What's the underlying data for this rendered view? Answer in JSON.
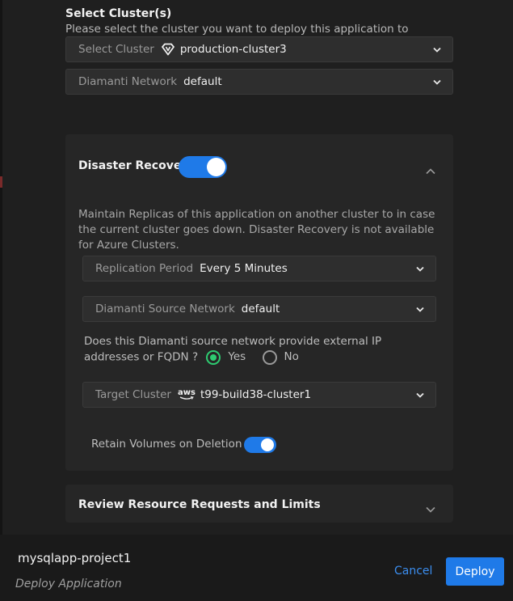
{
  "select_clusters": {
    "title": "Select Cluster(s)",
    "subtitle": "Please select the cluster you want to deploy this application to",
    "cluster_label": "Select Cluster",
    "cluster_value": "production-cluster3",
    "cluster_icon": "diamanti-logo-icon",
    "network_label": "Diamanti Network",
    "network_value": "default"
  },
  "disaster_recovery": {
    "title": "Disaster Recovery",
    "enabled": true,
    "expanded": true,
    "description": "Maintain Replicas of this application on another cluster to in case the current cluster goes down. Disaster Recovery is not available for Azure Clusters.",
    "replication_label": "Replication Period",
    "replication_value": "Every 5 Minutes",
    "source_network_label": "Diamanti Source Network",
    "source_network_value": "default",
    "question": "Does this Diamanti source network provide external IP addresses or FQDN ?",
    "options": [
      {
        "label": "Yes",
        "selected": true
      },
      {
        "label": "No",
        "selected": false
      }
    ],
    "target_label": "Target Cluster",
    "target_icon_text": "aws",
    "target_value": "t99-build38-cluster1",
    "retain_label": "Retain Volumes on Deletion",
    "retain_enabled": true
  },
  "review": {
    "title": "Review Resource Requests and Limits",
    "expanded": false
  },
  "footer": {
    "project_name": "mysqlapp-project1",
    "subtitle": "Deploy Application",
    "cancel_label": "Cancel",
    "deploy_label": "Deploy"
  },
  "colors": {
    "accent": "#1f7ae8",
    "selected_radio": "#2ecc71",
    "background": "#1f1f1f",
    "panel": "#262626"
  }
}
